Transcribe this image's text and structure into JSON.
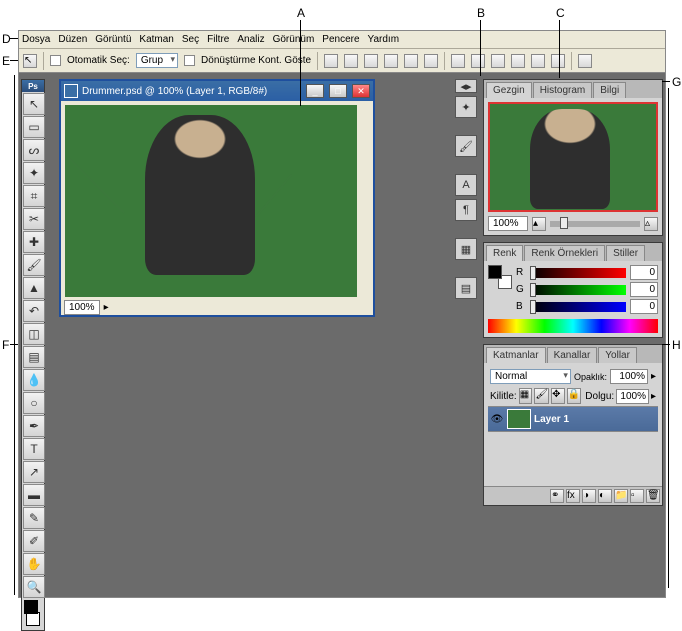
{
  "annotations": {
    "A": "A",
    "B": "B",
    "C": "C",
    "D": "D",
    "E": "E",
    "F": "F",
    "G": "G",
    "H": "H"
  },
  "menu": [
    "Dosya",
    "Düzen",
    "Görüntü",
    "Katman",
    "Seç",
    "Filtre",
    "Analiz",
    "Görünüm",
    "Pencere",
    "Yardım"
  ],
  "options": {
    "auto_select": "Otomatik Seç:",
    "group": "Grup",
    "transform_controls": "Dönüştürme Kont. Göste"
  },
  "doc": {
    "title": "Drummer.psd @ 100% (Layer 1, RGB/8#)",
    "zoom": "100%"
  },
  "toolbox_logo": "Ps",
  "tools": [
    "move",
    "marquee",
    "lasso",
    "wand",
    "crop",
    "slice",
    "heal",
    "brush",
    "stamp",
    "history",
    "eraser",
    "gradient",
    "blur",
    "dodge",
    "pen",
    "type",
    "path",
    "shape",
    "notes",
    "eyedrop",
    "hand",
    "zoom"
  ],
  "dock_icons": [
    "tools",
    "brushes",
    "char",
    "para",
    "clone"
  ],
  "navigator": {
    "tabs": [
      "Gezgin",
      "Histogram",
      "Bilgi"
    ],
    "zoom": "100%"
  },
  "color": {
    "tabs": [
      "Renk",
      "Renk Örnekleri",
      "Stiller"
    ],
    "channels": {
      "r": "R",
      "g": "G",
      "b": "B"
    },
    "values": {
      "r": "0",
      "g": "0",
      "b": "0"
    }
  },
  "layers": {
    "tabs": [
      "Katmanlar",
      "Kanallar",
      "Yollar"
    ],
    "blend": "Normal",
    "opacity_label": "Opaklık:",
    "opacity": "100%",
    "lock_label": "Kilitle:",
    "fill_label": "Dolgu:",
    "fill": "100%",
    "layer_name": "Layer 1"
  }
}
